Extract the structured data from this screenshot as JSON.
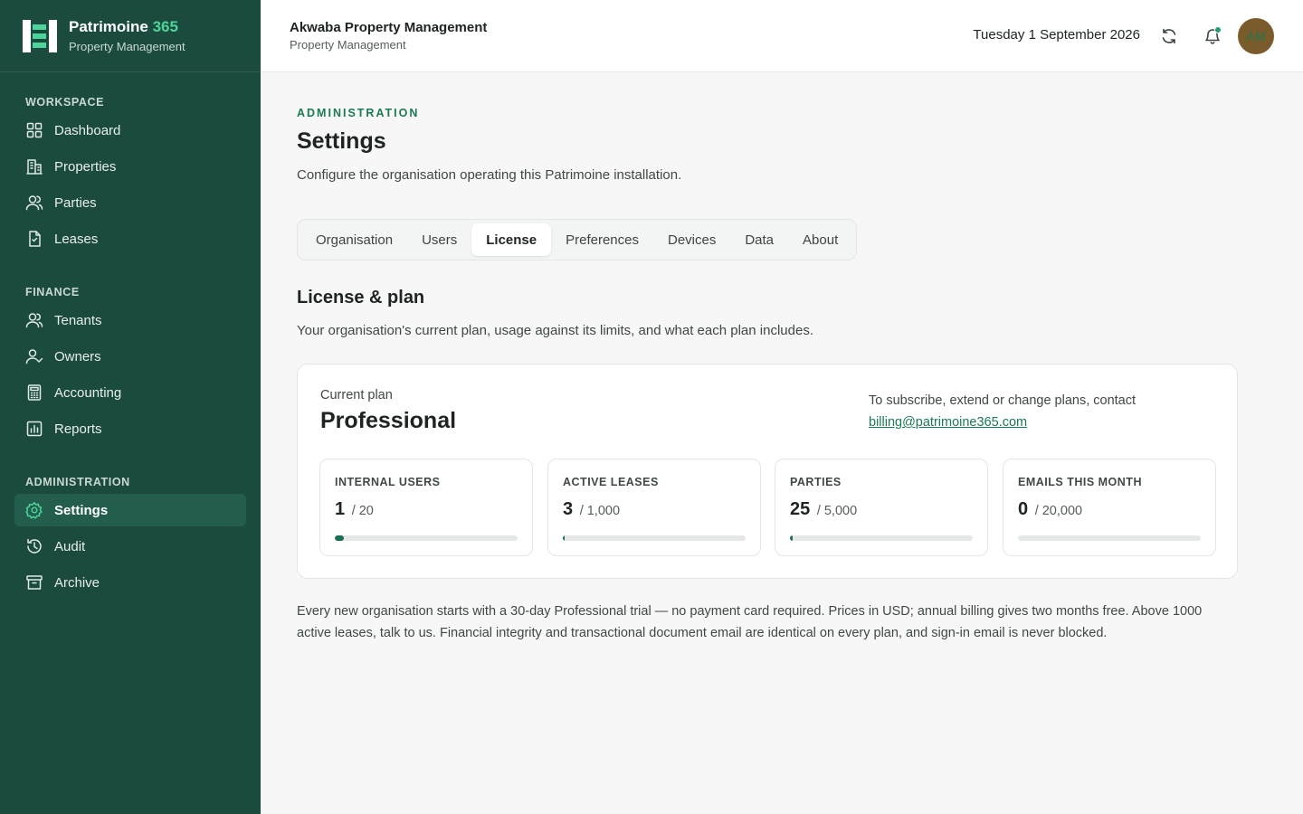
{
  "brand": {
    "name": "Patrimoine",
    "name_accent": "365",
    "subtitle": "Property Management"
  },
  "sidebar": {
    "sections": [
      {
        "heading": "WORKSPACE",
        "items": [
          {
            "label": "Dashboard",
            "icon": "grid-icon"
          },
          {
            "label": "Properties",
            "icon": "building-icon"
          },
          {
            "label": "Parties",
            "icon": "users-icon"
          },
          {
            "label": "Leases",
            "icon": "document-icon"
          }
        ]
      },
      {
        "heading": "FINANCE",
        "items": [
          {
            "label": "Tenants",
            "icon": "users-icon"
          },
          {
            "label": "Owners",
            "icon": "user-check-icon"
          },
          {
            "label": "Accounting",
            "icon": "calculator-icon"
          },
          {
            "label": "Reports",
            "icon": "bar-chart-icon"
          }
        ]
      },
      {
        "heading": "ADMINISTRATION",
        "items": [
          {
            "label": "Settings",
            "icon": "gear-icon",
            "active": true
          },
          {
            "label": "Audit",
            "icon": "history-icon"
          },
          {
            "label": "Archive",
            "icon": "archive-icon"
          }
        ]
      }
    ]
  },
  "topbar": {
    "org_name": "Akwaba Property Management",
    "org_subtitle": "Property Management",
    "date": "Tuesday 1 September 2026",
    "avatar_initials": "AM"
  },
  "page": {
    "eyebrow": "ADMINISTRATION",
    "title": "Settings",
    "description": "Configure the organisation operating this Patrimoine installation."
  },
  "tabs": [
    {
      "label": "Organisation"
    },
    {
      "label": "Users"
    },
    {
      "label": "License",
      "active": true
    },
    {
      "label": "Preferences"
    },
    {
      "label": "Devices"
    },
    {
      "label": "Data"
    },
    {
      "label": "About"
    }
  ],
  "license": {
    "title": "License & plan",
    "description": "Your organisation's current plan, usage against its limits, and what each plan includes.",
    "current_plan_label": "Current plan",
    "plan_name": "Professional",
    "contact_text": "To subscribe, extend or change plans, contact",
    "contact_email": "billing@patrimoine365.com",
    "usage": [
      {
        "label": "INTERNAL USERS",
        "value": "1",
        "limit": "/ 20",
        "fraction": 0.05
      },
      {
        "label": "ACTIVE LEASES",
        "value": "3",
        "limit": "/ 1,000",
        "fraction": 0.003
      },
      {
        "label": "PARTIES",
        "value": "25",
        "limit": "/ 5,000",
        "fraction": 0.005
      },
      {
        "label": "EMAILS THIS MONTH",
        "value": "0",
        "limit": "/ 20,000",
        "fraction": 0
      }
    ],
    "footnote": "Every new organisation starts with a 30-day Professional trial — no payment card required. Prices in USD; annual billing gives two months free. Above 1000 active leases, talk to us. Financial integrity and transactional document email are identical on every plan, and sign-in email is never blocked."
  }
}
